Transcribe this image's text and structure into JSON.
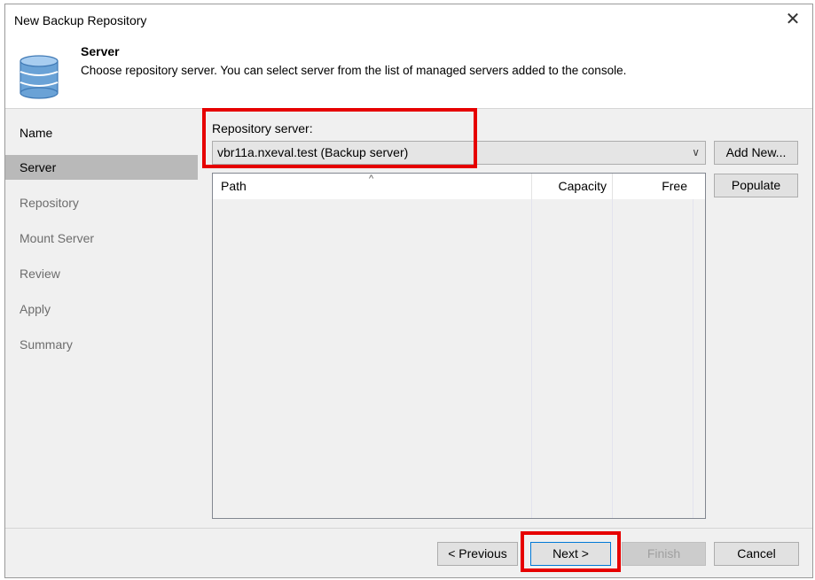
{
  "window": {
    "title": "New Backup Repository",
    "close_glyph": "✕"
  },
  "header": {
    "icon": "database-icon",
    "title": "Server",
    "description": "Choose repository server. You can select server from the list of managed servers added to the console."
  },
  "nav": {
    "items": [
      {
        "label": "Name",
        "state": "done"
      },
      {
        "label": "Server",
        "state": "active"
      },
      {
        "label": "Repository",
        "state": "pending"
      },
      {
        "label": "Mount Server",
        "state": "pending"
      },
      {
        "label": "Review",
        "state": "pending"
      },
      {
        "label": "Apply",
        "state": "pending"
      },
      {
        "label": "Summary",
        "state": "pending"
      }
    ]
  },
  "server": {
    "label": "Repository server:",
    "selected": "vbr11a.nxeval.test (Backup server)",
    "add_new_label": "Add New...",
    "populate_label": "Populate"
  },
  "table": {
    "columns": [
      "Path",
      "Capacity",
      "Free"
    ],
    "sort_glyph": "^",
    "rows": []
  },
  "footer": {
    "previous_label": "< Previous",
    "next_label": "Next >",
    "finish_label": "Finish",
    "cancel_label": "Cancel"
  },
  "colors": {
    "highlight": "#e60000",
    "focus_border": "#0078d7",
    "nav_active_bg": "#b9b9b9",
    "database_icon": "#6aa2d6"
  }
}
